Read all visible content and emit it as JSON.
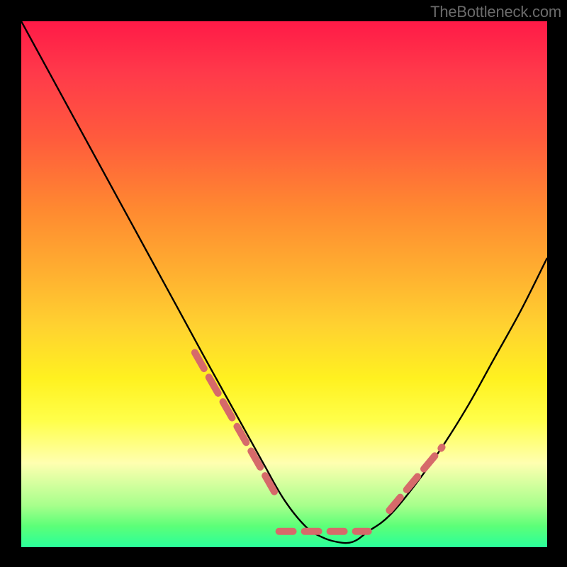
{
  "watermark": "TheBottleneck.com",
  "colors": {
    "page_bg": "#000000",
    "gradient_top": "#ff1a47",
    "gradient_bottom": "#2aff9a",
    "curve_stroke": "#000000",
    "overlay_stroke": "#d66a6a"
  },
  "chart_data": {
    "type": "line",
    "title": "",
    "xlabel": "",
    "ylabel": "",
    "xlim": [
      0,
      100
    ],
    "ylim": [
      0,
      100
    ],
    "legend": [],
    "grid": false,
    "series": [
      {
        "name": "main-curve",
        "x": [
          0,
          6,
          12,
          18,
          24,
          30,
          36,
          41,
          46,
          50,
          54,
          57,
          60,
          63,
          66,
          70,
          75,
          80,
          85,
          90,
          95,
          100
        ],
        "y": [
          100,
          89,
          78,
          67,
          56,
          45,
          34,
          25,
          16,
          9,
          4,
          2,
          1,
          1,
          3,
          6,
          12,
          19,
          27,
          36,
          45,
          55
        ]
      },
      {
        "name": "overlay-dashes-left",
        "stroke": "#d66a6a",
        "x": [
          33,
          49
        ],
        "y": [
          37,
          9
        ]
      },
      {
        "name": "overlay-dashes-bottom",
        "stroke": "#d66a6a",
        "x": [
          49,
          66
        ],
        "y": [
          3,
          3
        ]
      },
      {
        "name": "overlay-dashes-right",
        "stroke": "#d66a6a",
        "x": [
          70,
          80
        ],
        "y": [
          7,
          19
        ]
      }
    ]
  }
}
